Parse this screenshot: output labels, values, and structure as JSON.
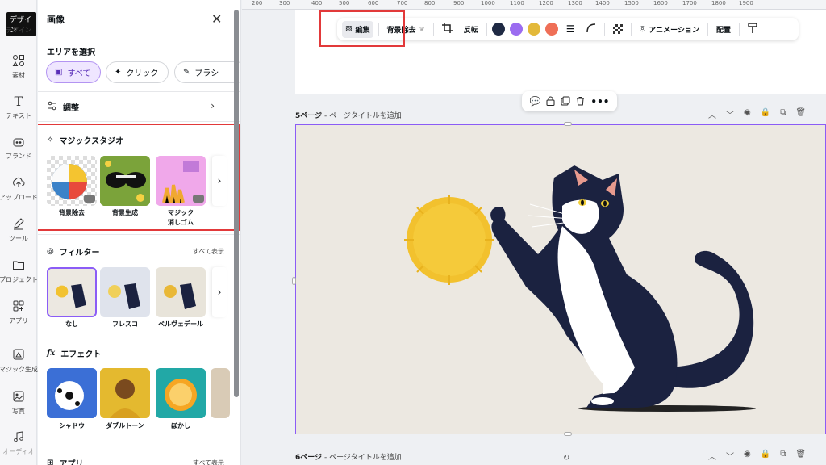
{
  "rail": {
    "tooltip": "デザイン",
    "items": [
      {
        "label": "デザイン",
        "icon": "layout-icon"
      },
      {
        "label": "素材",
        "icon": "elements-icon"
      },
      {
        "label": "テキスト",
        "icon": "text-icon"
      },
      {
        "label": "ブランド",
        "icon": "brand-icon"
      },
      {
        "label": "アップロード",
        "icon": "upload-icon"
      },
      {
        "label": "ツール",
        "icon": "draw-icon"
      },
      {
        "label": "プロジェクト",
        "icon": "folder-icon"
      },
      {
        "label": "アプリ",
        "icon": "apps-icon"
      },
      {
        "label": "マジック生成",
        "icon": "magic-media-icon"
      },
      {
        "label": "写真",
        "icon": "photo-icon"
      },
      {
        "label": "オーディオ",
        "icon": "audio-icon"
      }
    ]
  },
  "panel": {
    "title": "画像",
    "area_label": "エリアを選択",
    "area_chips": [
      "すべて",
      "クリック",
      "ブラシ"
    ],
    "adjust_label": "調整",
    "magic_studio_label": "マジックスタジオ",
    "magic_items": [
      "背景除去",
      "背景生成",
      "マジック\n消しゴム"
    ],
    "magic_item3_line1": "マジック",
    "magic_item3_line2": "消しゴム",
    "filter_label": "フィルター",
    "filter_see_all": "すべて表示",
    "filters": [
      "なし",
      "フレスコ",
      "ベルヴェデール"
    ],
    "effect_label": "エフェクト",
    "effects": [
      "シャドウ",
      "ダブルトーン",
      "ぼかし"
    ],
    "apps_label": "アプリ",
    "apps_see_all": "すべて表示"
  },
  "ruler": [
    "200",
    "300",
    "400",
    "500",
    "600",
    "700",
    "800",
    "900",
    "1000",
    "1100",
    "1200",
    "1300",
    "1400",
    "1500",
    "1600",
    "1700",
    "1800",
    "1900"
  ],
  "toolbar": {
    "edit": "編集",
    "bg_remove": "背景除去",
    "flip": "反転",
    "colors": [
      "#1f2a44",
      "#9b6cf0",
      "#e3b93a",
      "#ef6f57"
    ],
    "animation": "アニメーション",
    "position": "配置"
  },
  "page5": {
    "num": "5ページ",
    "title_hint": "ページタイトルを追加"
  },
  "page6": {
    "num": "6ページ",
    "title_hint": "ページタイトルを追加"
  }
}
